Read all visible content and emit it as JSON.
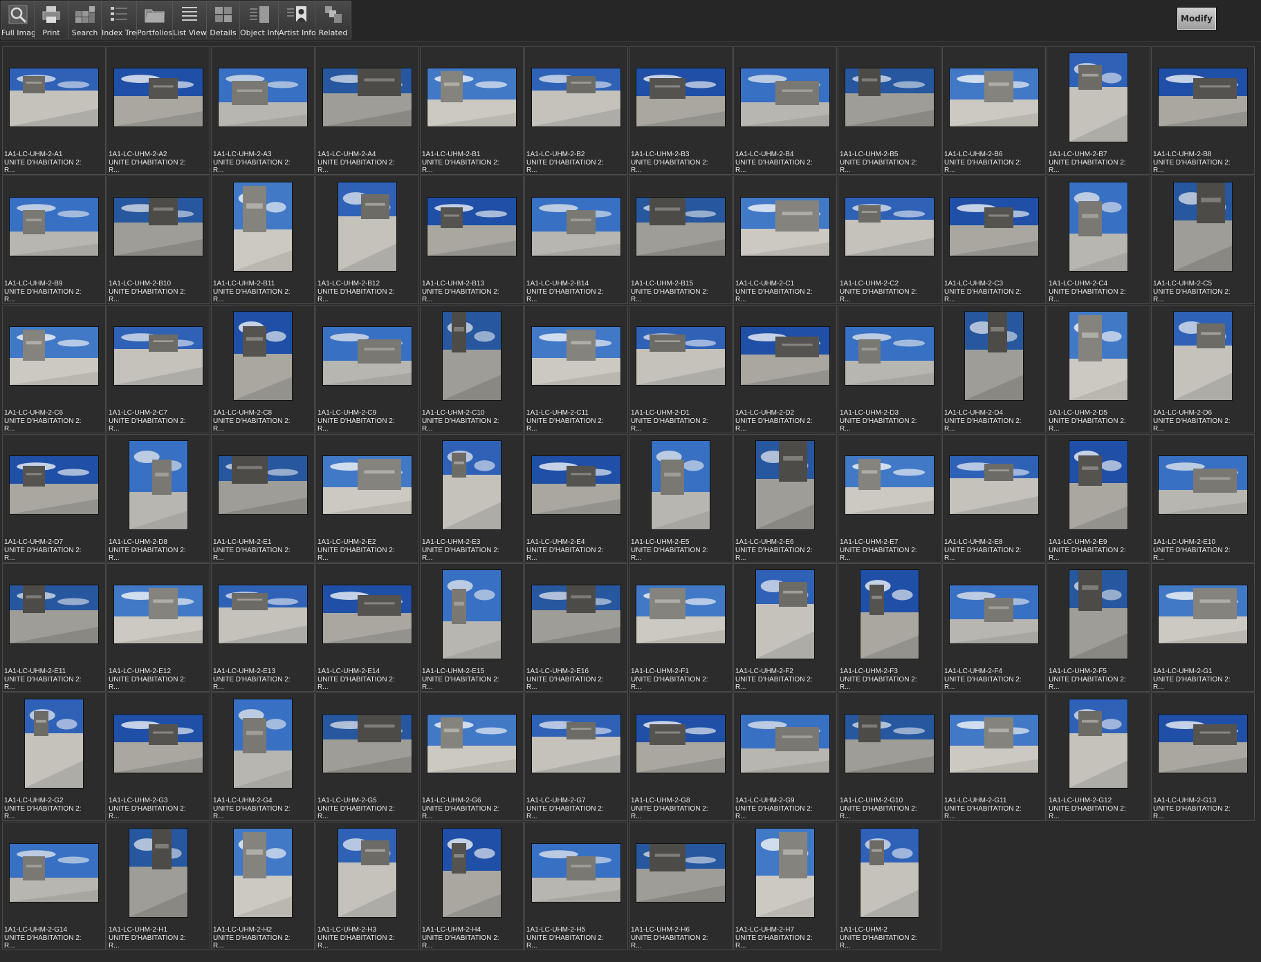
{
  "toolbar": {
    "tools": [
      {
        "label": "Full Image",
        "icon": "magnifier-icon"
      },
      {
        "label": "Print",
        "icon": "printer-icon"
      },
      {
        "label": "Search",
        "icon": "search-grid-icon"
      },
      {
        "label": "Index Tree",
        "icon": "index-tree-icon"
      },
      {
        "label": "Portfolios",
        "icon": "folder-icon"
      },
      {
        "label": "List View",
        "icon": "list-icon"
      },
      {
        "label": "Details",
        "icon": "details-icon"
      },
      {
        "label": "Object Info",
        "icon": "object-info-icon"
      },
      {
        "label": "Artist  Info",
        "icon": "artist-portrait-icon"
      },
      {
        "label": "Related",
        "icon": "related-icon"
      }
    ],
    "modify_label": "Modify"
  },
  "records": [
    {
      "id": "1A1-LC-UHM-2-A1",
      "title": "UNITE D'HABITATION 2:",
      "more": "R...",
      "orientation": "landscape"
    },
    {
      "id": "1A1-LC-UHM-2-A2",
      "title": "UNITE D'HABITATION 2:",
      "more": "R...",
      "orientation": "landscape"
    },
    {
      "id": "1A1-LC-UHM-2-A3",
      "title": "UNITE D'HABITATION 2:",
      "more": "R...",
      "orientation": "landscape"
    },
    {
      "id": "1A1-LC-UHM-2-A4",
      "title": "UNITE D'HABITATION 2:",
      "more": "R...",
      "orientation": "landscape"
    },
    {
      "id": "1A1-LC-UHM-2-B1",
      "title": "UNITE D'HABITATION 2:",
      "more": "R...",
      "orientation": "landscape"
    },
    {
      "id": "1A1-LC-UHM-2-B2",
      "title": "UNITE D'HABITATION 2:",
      "more": "R...",
      "orientation": "landscape"
    },
    {
      "id": "1A1-LC-UHM-2-B3",
      "title": "UNITE D'HABITATION 2:",
      "more": "R...",
      "orientation": "landscape"
    },
    {
      "id": "1A1-LC-UHM-2-B4",
      "title": "UNITE D'HABITATION 2:",
      "more": "R...",
      "orientation": "landscape"
    },
    {
      "id": "1A1-LC-UHM-2-B5",
      "title": "UNITE D'HABITATION 2:",
      "more": "R...",
      "orientation": "landscape"
    },
    {
      "id": "1A1-LC-UHM-2-B6",
      "title": "UNITE D'HABITATION 2:",
      "more": "R...",
      "orientation": "landscape"
    },
    {
      "id": "1A1-LC-UHM-2-B7",
      "title": "UNITE D'HABITATION 2:",
      "more": "R...",
      "orientation": "portrait"
    },
    {
      "id": "1A1-LC-UHM-2-B8",
      "title": "UNITE D'HABITATION 2:",
      "more": "R...",
      "orientation": "landscape"
    },
    {
      "id": "1A1-LC-UHM-2-B9",
      "title": "UNITE D'HABITATION 2:",
      "more": "R...",
      "orientation": "landscape"
    },
    {
      "id": "1A1-LC-UHM-2-B10",
      "title": "UNITE D'HABITATION 2:",
      "more": "R...",
      "orientation": "landscape"
    },
    {
      "id": "1A1-LC-UHM-2-B11",
      "title": "UNITE D'HABITATION 2:",
      "more": "R...",
      "orientation": "portrait"
    },
    {
      "id": "1A1-LC-UHM-2-B12",
      "title": "UNITE D'HABITATION 2:",
      "more": "R...",
      "orientation": "portrait"
    },
    {
      "id": "1A1-LC-UHM-2-B13",
      "title": "UNITE D'HABITATION 2:",
      "more": "R...",
      "orientation": "landscape"
    },
    {
      "id": "1A1-LC-UHM-2-B14",
      "title": "UNITE D'HABITATION 2:",
      "more": "R...",
      "orientation": "landscape"
    },
    {
      "id": "1A1-LC-UHM-2-B15",
      "title": "UNITE D'HABITATION 2:",
      "more": "R...",
      "orientation": "landscape"
    },
    {
      "id": "1A1-LC-UHM-2-C1",
      "title": "UNITE D'HABITATION 2:",
      "more": "R...",
      "orientation": "landscape"
    },
    {
      "id": "1A1-LC-UHM-2-C2",
      "title": "UNITE D'HABITATION 2:",
      "more": "R...",
      "orientation": "landscape"
    },
    {
      "id": "1A1-LC-UHM-2-C3",
      "title": "UNITE D'HABITATION 2:",
      "more": "R...",
      "orientation": "landscape"
    },
    {
      "id": "1A1-LC-UHM-2-C4",
      "title": "UNITE D'HABITATION 2:",
      "more": "R...",
      "orientation": "portrait"
    },
    {
      "id": "1A1-LC-UHM-2-C5",
      "title": "UNITE D'HABITATION 2:",
      "more": "R...",
      "orientation": "portrait"
    },
    {
      "id": "1A1-LC-UHM-2-C6",
      "title": "UNITE D'HABITATION 2:",
      "more": "R...",
      "orientation": "landscape"
    },
    {
      "id": "1A1-LC-UHM-2-C7",
      "title": "UNITE D'HABITATION 2:",
      "more": "R...",
      "orientation": "landscape"
    },
    {
      "id": "1A1-LC-UHM-2-C8",
      "title": "UNITE D'HABITATION 2:",
      "more": "R...",
      "orientation": "portrait"
    },
    {
      "id": "1A1-LC-UHM-2-C9",
      "title": "UNITE D'HABITATION 2:",
      "more": "R...",
      "orientation": "landscape"
    },
    {
      "id": "1A1-LC-UHM-2-C10",
      "title": "UNITE D'HABITATION 2:",
      "more": "R...",
      "orientation": "portrait"
    },
    {
      "id": "1A1-LC-UHM-2-C11",
      "title": "UNITE D'HABITATION 2:",
      "more": "R...",
      "orientation": "landscape"
    },
    {
      "id": "1A1-LC-UHM-2-D1",
      "title": "UNITE D'HABITATION 2:",
      "more": "R...",
      "orientation": "landscape"
    },
    {
      "id": "1A1-LC-UHM-2-D2",
      "title": "UNITE D'HABITATION 2:",
      "more": "R...",
      "orientation": "landscape"
    },
    {
      "id": "1A1-LC-UHM-2-D3",
      "title": "UNITE D'HABITATION 2:",
      "more": "R...",
      "orientation": "landscape"
    },
    {
      "id": "1A1-LC-UHM-2-D4",
      "title": "UNITE D'HABITATION 2:",
      "more": "R...",
      "orientation": "portrait"
    },
    {
      "id": "1A1-LC-UHM-2-D5",
      "title": "UNITE D'HABITATION 2:",
      "more": "R...",
      "orientation": "portrait"
    },
    {
      "id": "1A1-LC-UHM-2-D6",
      "title": "UNITE D'HABITATION 2:",
      "more": "R...",
      "orientation": "portrait"
    },
    {
      "id": "1A1-LC-UHM-2-D7",
      "title": "UNITE D'HABITATION 2:",
      "more": "R...",
      "orientation": "landscape"
    },
    {
      "id": "1A1-LC-UHM-2-D8",
      "title": "UNITE D'HABITATION 2:",
      "more": "R...",
      "orientation": "portrait"
    },
    {
      "id": "1A1-LC-UHM-2-E1",
      "title": "UNITE D'HABITATION 2:",
      "more": "R...",
      "orientation": "landscape"
    },
    {
      "id": "1A1-LC-UHM-2-E2",
      "title": "UNITE D'HABITATION 2:",
      "more": "R...",
      "orientation": "landscape"
    },
    {
      "id": "1A1-LC-UHM-2-E3",
      "title": "UNITE D'HABITATION 2:",
      "more": "R...",
      "orientation": "portrait"
    },
    {
      "id": "1A1-LC-UHM-2-E4",
      "title": "UNITE D'HABITATION 2:",
      "more": "R...",
      "orientation": "landscape"
    },
    {
      "id": "1A1-LC-UHM-2-E5",
      "title": "UNITE D'HABITATION 2:",
      "more": "R...",
      "orientation": "portrait"
    },
    {
      "id": "1A1-LC-UHM-2-E6",
      "title": "UNITE D'HABITATION 2:",
      "more": "R...",
      "orientation": "portrait"
    },
    {
      "id": "1A1-LC-UHM-2-E7",
      "title": "UNITE D'HABITATION 2:",
      "more": "R...",
      "orientation": "landscape"
    },
    {
      "id": "1A1-LC-UHM-2-E8",
      "title": "UNITE D'HABITATION 2:",
      "more": "R...",
      "orientation": "landscape"
    },
    {
      "id": "1A1-LC-UHM-2-E9",
      "title": "UNITE D'HABITATION 2:",
      "more": "R...",
      "orientation": "portrait"
    },
    {
      "id": "1A1-LC-UHM-2-E10",
      "title": "UNITE D'HABITATION 2:",
      "more": "R...",
      "orientation": "landscape"
    },
    {
      "id": "1A1-LC-UHM-2-E11",
      "title": "UNITE D'HABITATION 2:",
      "more": "R...",
      "orientation": "landscape"
    },
    {
      "id": "1A1-LC-UHM-2-E12",
      "title": "UNITE D'HABITATION 2:",
      "more": "R...",
      "orientation": "landscape"
    },
    {
      "id": "1A1-LC-UHM-2-E13",
      "title": "UNITE D'HABITATION 2:",
      "more": "R...",
      "orientation": "landscape"
    },
    {
      "id": "1A1-LC-UHM-2-E14",
      "title": "UNITE D'HABITATION 2:",
      "more": "R...",
      "orientation": "landscape"
    },
    {
      "id": "1A1-LC-UHM-2-E15",
      "title": "UNITE D'HABITATION 2:",
      "more": "R...",
      "orientation": "portrait"
    },
    {
      "id": "1A1-LC-UHM-2-E16",
      "title": "UNITE D'HABITATION 2:",
      "more": "R...",
      "orientation": "landscape"
    },
    {
      "id": "1A1-LC-UHM-2-F1",
      "title": "UNITE D'HABITATION 2:",
      "more": "R...",
      "orientation": "landscape"
    },
    {
      "id": "1A1-LC-UHM-2-F2",
      "title": "UNITE D'HABITATION 2:",
      "more": "R...",
      "orientation": "portrait"
    },
    {
      "id": "1A1-LC-UHM-2-F3",
      "title": "UNITE D'HABITATION 2:",
      "more": "R...",
      "orientation": "portrait"
    },
    {
      "id": "1A1-LC-UHM-2-F4",
      "title": "UNITE D'HABITATION 2:",
      "more": "R...",
      "orientation": "landscape"
    },
    {
      "id": "1A1-LC-UHM-2-F5",
      "title": "UNITE D'HABITATION 2:",
      "more": "R...",
      "orientation": "portrait"
    },
    {
      "id": "1A1-LC-UHM-2-G1",
      "title": "UNITE D'HABITATION 2:",
      "more": "R...",
      "orientation": "landscape"
    },
    {
      "id": "1A1-LC-UHM-2-G2",
      "title": "UNITE D'HABITATION 2:",
      "more": "R...",
      "orientation": "portrait"
    },
    {
      "id": "1A1-LC-UHM-2-G3",
      "title": "UNITE D'HABITATION 2:",
      "more": "R...",
      "orientation": "landscape"
    },
    {
      "id": "1A1-LC-UHM-2-G4",
      "title": "UNITE D'HABITATION 2:",
      "more": "R...",
      "orientation": "portrait"
    },
    {
      "id": "1A1-LC-UHM-2-G5",
      "title": "UNITE D'HABITATION 2:",
      "more": "R...",
      "orientation": "landscape"
    },
    {
      "id": "1A1-LC-UHM-2-G6",
      "title": "UNITE D'HABITATION 2:",
      "more": "R...",
      "orientation": "landscape"
    },
    {
      "id": "1A1-LC-UHM-2-G7",
      "title": "UNITE D'HABITATION 2:",
      "more": "R...",
      "orientation": "landscape"
    },
    {
      "id": "1A1-LC-UHM-2-G8",
      "title": "UNITE D'HABITATION 2:",
      "more": "R...",
      "orientation": "landscape"
    },
    {
      "id": "1A1-LC-UHM-2-G9",
      "title": "UNITE D'HABITATION 2:",
      "more": "R...",
      "orientation": "landscape"
    },
    {
      "id": "1A1-LC-UHM-2-G10",
      "title": "UNITE D'HABITATION 2:",
      "more": "R...",
      "orientation": "landscape"
    },
    {
      "id": "1A1-LC-UHM-2-G11",
      "title": "UNITE D'HABITATION 2:",
      "more": "R...",
      "orientation": "landscape"
    },
    {
      "id": "1A1-LC-UHM-2-G12",
      "title": "UNITE D'HABITATION 2:",
      "more": "R...",
      "orientation": "portrait"
    },
    {
      "id": "1A1-LC-UHM-2-G13",
      "title": "UNITE D'HABITATION 2:",
      "more": "R...",
      "orientation": "landscape"
    },
    {
      "id": "1A1-LC-UHM-2-G14",
      "title": "UNITE D'HABITATION 2:",
      "more": "R...",
      "orientation": "landscape"
    },
    {
      "id": "1A1-LC-UHM-2-H1",
      "title": "UNITE D'HABITATION 2:",
      "more": "R...",
      "orientation": "portrait"
    },
    {
      "id": "1A1-LC-UHM-2-H2",
      "title": "UNITE D'HABITATION 2:",
      "more": "R...",
      "orientation": "portrait"
    },
    {
      "id": "1A1-LC-UHM-2-H3",
      "title": "UNITE D'HABITATION 2:",
      "more": "R...",
      "orientation": "portrait"
    },
    {
      "id": "1A1-LC-UHM-2-H4",
      "title": "UNITE D'HABITATION 2:",
      "more": "R...",
      "orientation": "portrait"
    },
    {
      "id": "1A1-LC-UHM-2-H5",
      "title": "UNITE D'HABITATION 2:",
      "more": "R...",
      "orientation": "landscape"
    },
    {
      "id": "1A1-LC-UHM-2-H6",
      "title": "UNITE D'HABITATION 2:",
      "more": "R...",
      "orientation": "landscape"
    },
    {
      "id": "1A1-LC-UHM-2-H7",
      "title": "UNITE D'HABITATION 2:",
      "more": "R...",
      "orientation": "portrait"
    },
    {
      "id": "1A1-LC-UHM-2",
      "title": "UNITE D'HABITATION 2:",
      "more": "R...",
      "orientation": "portrait"
    }
  ],
  "colors": {
    "background": "#2b2b2b",
    "sky": "#2d5fb8",
    "concrete": "#b9b7b0"
  }
}
